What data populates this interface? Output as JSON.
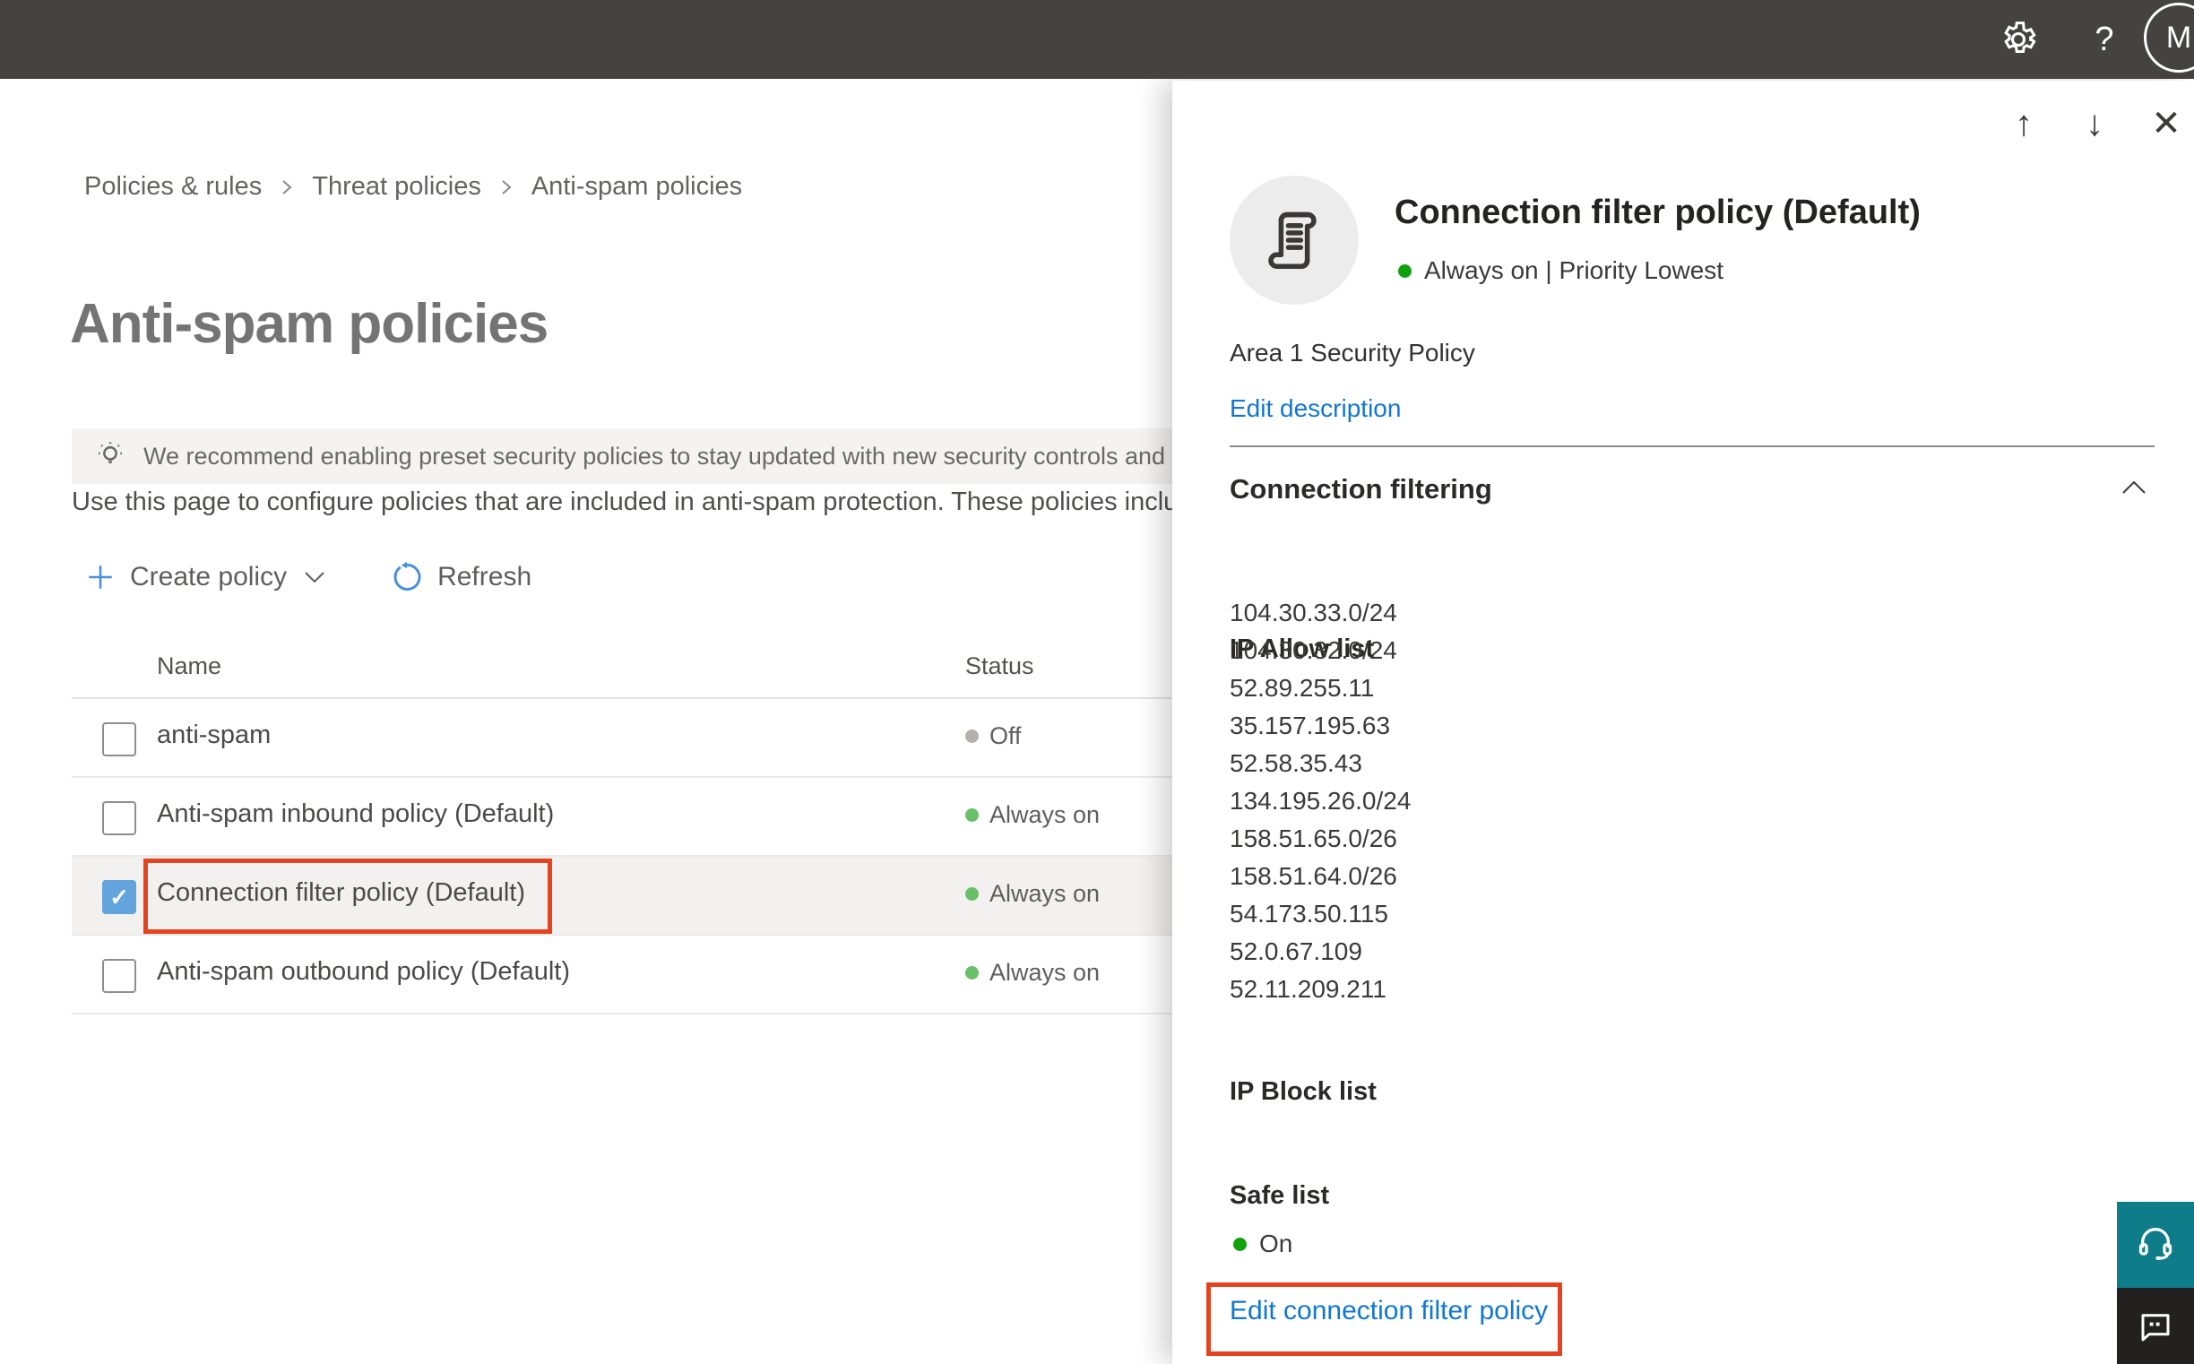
{
  "topbar": {
    "help_label": "?",
    "avatar_initial": "M"
  },
  "breadcrumb": {
    "items": [
      "Policies & rules",
      "Threat policies",
      "Anti-spam policies"
    ]
  },
  "page": {
    "title": "Anti-spam policies",
    "banner": {
      "text": "We recommend enabling preset security policies to stay updated with new security controls and our recomme"
    },
    "description": "Use this page to configure policies that are included in anti-spam protection. These policies include",
    "toolbar": {
      "create_policy_label": "Create policy",
      "refresh_label": "Refresh"
    },
    "table": {
      "columns": {
        "name": "Name",
        "status": "Status"
      },
      "rows": [
        {
          "name": "anti-spam",
          "status": "Off"
        },
        {
          "name": "Anti-spam inbound policy (Default)",
          "status": "Always on"
        },
        {
          "name": "Connection filter policy (Default)",
          "status": "Always on"
        },
        {
          "name": "Anti-spam outbound policy (Default)",
          "status": "Always on"
        }
      ]
    }
  },
  "flyout": {
    "title": "Connection filter policy (Default)",
    "status_line": "Always on | Priority Lowest",
    "description": "Area 1 Security Policy",
    "edit_description_label": "Edit description",
    "section_title": "Connection filtering",
    "ip_allow": {
      "title": "IP Allow list",
      "ips": [
        "104.30.33.0/24",
        "104.30.32.0/24",
        "52.89.255.11",
        "35.157.195.63",
        "52.58.35.43",
        "134.195.26.0/24",
        "158.51.65.0/26",
        "158.51.64.0/26",
        "54.173.50.115",
        "52.0.67.109",
        "52.11.209.211"
      ]
    },
    "ip_block": {
      "title": "IP Block list"
    },
    "safe_list": {
      "title": "Safe list",
      "status": "On"
    },
    "edit_link_label": "Edit connection filter policy"
  },
  "colors": {
    "topbar": "#454340",
    "accent_blue": "#1077d4",
    "annotation_red": "#e5431f",
    "status_green_soft": "#6abf69",
    "status_green_bright": "#12a10e",
    "status_gray": "#b3b0ad",
    "support_teal": "#0e7d89",
    "feedback_dark": "#232120"
  }
}
